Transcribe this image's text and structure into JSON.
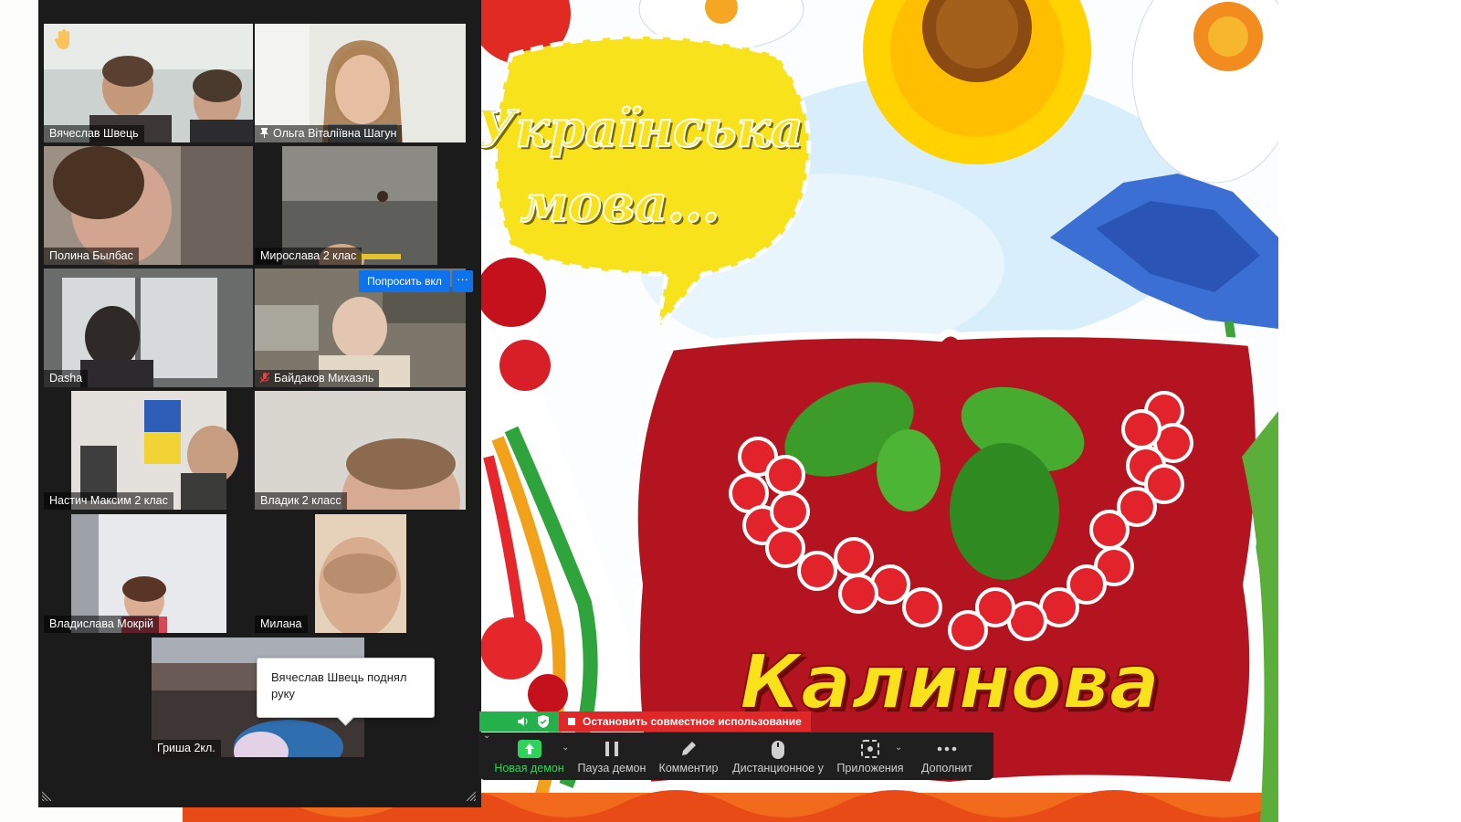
{
  "shared_slide": {
    "heading_line1": "Українська",
    "heading_line2": "мова...",
    "banner_word": "Калинова"
  },
  "gallery": {
    "participants": [
      {
        "name": "Вячеслав Швець",
        "hand_raised": true
      },
      {
        "name": "Ольга Віталіївна Шагун",
        "pinned": true,
        "active_speaker": true
      },
      {
        "name": "Полина Былбас"
      },
      {
        "name": "Мирослава 2 клас"
      },
      {
        "name": "Dasha"
      },
      {
        "name": "Байдаков Михаэль",
        "muted": true
      },
      {
        "name": "Настич Максим 2 клас"
      },
      {
        "name": "Владик 2 класс"
      },
      {
        "name": "Владислава Мокрій"
      },
      {
        "name": "Милана"
      },
      {
        "name": "Гриша 2кл."
      }
    ],
    "ask_button_label": "Попросить вкл",
    "more_button_label": "···",
    "notification": "Вячеслав Швець поднял руку"
  },
  "share_controls": {
    "stop_label": "Остановить совместное использование"
  },
  "toolbar": {
    "items": [
      {
        "label": "Новая демон",
        "icon": "share-screen-icon"
      },
      {
        "label": "Пауза демон",
        "icon": "pause-icon"
      },
      {
        "label": "Комментир",
        "icon": "pen-icon"
      },
      {
        "label": "Дистанционное у",
        "icon": "mouse-icon"
      },
      {
        "label": "Приложения",
        "icon": "apps-icon"
      },
      {
        "label": "Дополнит",
        "icon": "more-icon"
      }
    ]
  },
  "colors": {
    "gallery_bg": "#1b1b1b",
    "toolbar_bg": "#1f1f1f",
    "accent_blue": "#0e72ed",
    "stop_red": "#e02828",
    "share_green": "#24b04b",
    "active_border": "#e8df3a",
    "slide_yellow": "#f7e21b",
    "slide_red": "#b3141f"
  }
}
